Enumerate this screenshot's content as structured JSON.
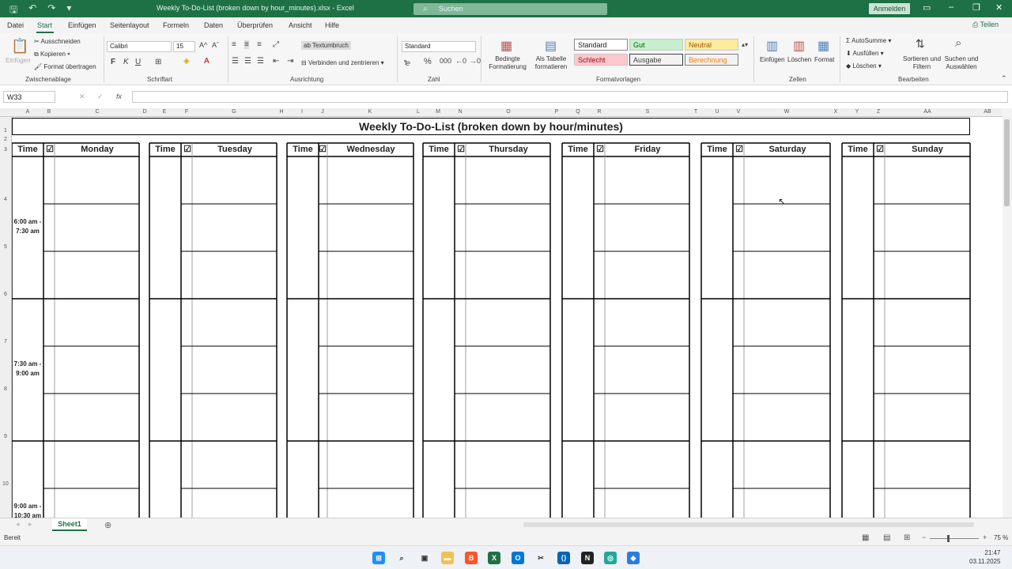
{
  "window": {
    "title": "Weekly To-Do-List (broken down by hour_minutes).xlsx  -  Excel",
    "search_label": "Suchen",
    "signin_label": "Anmelden"
  },
  "tabs": [
    "Datei",
    "Start",
    "Einfügen",
    "Seitenlayout",
    "Formeln",
    "Daten",
    "Überprüfen",
    "Ansicht",
    "Hilfe"
  ],
  "active_tab": "Start",
  "share_label": "Teilen",
  "ribbon": {
    "clipboard": {
      "paste": "Einfügen",
      "cut": "Ausschneiden",
      "copy": "Kopieren",
      "format_painter": "Format übertragen",
      "group": "Zwischenablage"
    },
    "font": {
      "name": "Calibri",
      "size": "15",
      "group": "Schriftart"
    },
    "alignment": {
      "wrap": "Textumbruch",
      "merge": "Verbinden und zentrieren",
      "group": "Ausrichtung"
    },
    "number": {
      "format": "Standard",
      "group": "Zahl"
    },
    "styles": {
      "conditional": "Bedingte Formatierung",
      "as_table": "Als Tabelle formatieren",
      "cells": [
        "Standard",
        "Gut",
        "Neutral",
        "Schlecht",
        "Ausgabe",
        "Berechnung"
      ],
      "group": "Formatvorlagen"
    },
    "cells_group": {
      "insert": "Einfügen",
      "delete": "Löschen",
      "format": "Format",
      "group": "Zellen"
    },
    "editing": {
      "autosum": "AutoSumme",
      "fill": "Ausfüllen",
      "clear": "Löschen",
      "sort": "Sortieren und Filtern",
      "find": "Suchen und Auswählen",
      "group": "Bearbeiten"
    }
  },
  "formula_bar": {
    "cell_ref": "W33",
    "value": ""
  },
  "column_headers": [
    "A",
    "B",
    "C",
    "D",
    "E",
    "F",
    "G",
    "H",
    "I",
    "J",
    "K",
    "L",
    "M",
    "N",
    "O",
    "P",
    "Q",
    "R",
    "S",
    "T",
    "U",
    "V",
    "W",
    "X",
    "Y",
    "Z",
    "AA",
    "AB"
  ],
  "row_headers": [
    "1",
    "2",
    "3",
    "4",
    "5",
    "6",
    "7",
    "8",
    "9",
    "10"
  ],
  "sheet": {
    "title": "Weekly To-Do-List (broken down by hour/minutes)",
    "time_label": "Time",
    "check_symbol": "☑",
    "days": [
      "Monday",
      "Tuesday",
      "Wednesday",
      "Thursday",
      "Friday",
      "Saturday",
      "Sunday"
    ],
    "slots": [
      "6:00 am - 7:30 am",
      "7:30 am - 9:00 am",
      "9:00 am - 10:30 am"
    ]
  },
  "sheet_tab": "Sheet1",
  "status": {
    "ready": "Bereit",
    "zoom": "75 %"
  },
  "clock": {
    "time": "21:47",
    "date": "03.11.2025"
  }
}
